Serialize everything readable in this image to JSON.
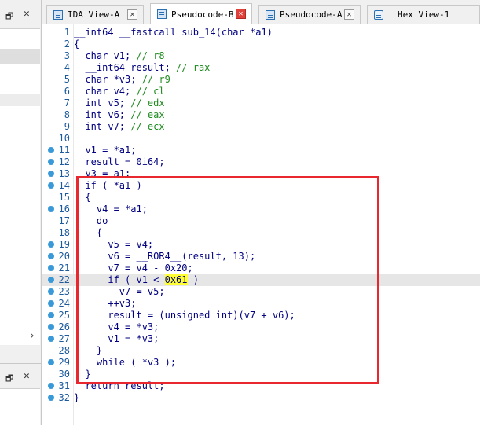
{
  "tabs": [
    {
      "label": "IDA View-A",
      "icon": "listing-icon",
      "active": false
    },
    {
      "label": "Pseudocode-B",
      "icon": "pseudocode-icon",
      "active": true
    },
    {
      "label": "Pseudocode-A",
      "icon": "pseudocode-icon",
      "active": false
    },
    {
      "label": "Hex View-1",
      "icon": "hex-icon",
      "active": false
    }
  ],
  "code": {
    "current_line": 22,
    "highlight_token": "0x61",
    "lines": [
      {
        "n": "1",
        "dot": false,
        "text": "__int64 __fastcall sub_14(char *a1)"
      },
      {
        "n": "2",
        "dot": false,
        "text": "{"
      },
      {
        "n": "3",
        "dot": false,
        "text": "  char v1; // r8"
      },
      {
        "n": "4",
        "dot": false,
        "text": "  __int64 result; // rax"
      },
      {
        "n": "5",
        "dot": false,
        "text": "  char *v3; // r9"
      },
      {
        "n": "6",
        "dot": false,
        "text": "  char v4; // cl"
      },
      {
        "n": "7",
        "dot": false,
        "text": "  int v5; // edx"
      },
      {
        "n": "8",
        "dot": false,
        "text": "  int v6; // eax"
      },
      {
        "n": "9",
        "dot": false,
        "text": "  int v7; // ecx"
      },
      {
        "n": "10",
        "dot": false,
        "text": ""
      },
      {
        "n": "11",
        "dot": true,
        "text": "  v1 = *a1;"
      },
      {
        "n": "12",
        "dot": true,
        "text": "  result = 0i64;"
      },
      {
        "n": "13",
        "dot": true,
        "text": "  v3 = a1;"
      },
      {
        "n": "14",
        "dot": true,
        "text": "  if ( *a1 )"
      },
      {
        "n": "15",
        "dot": false,
        "text": "  {"
      },
      {
        "n": "16",
        "dot": true,
        "text": "    v4 = *a1;"
      },
      {
        "n": "17",
        "dot": false,
        "text": "    do"
      },
      {
        "n": "18",
        "dot": false,
        "text": "    {"
      },
      {
        "n": "19",
        "dot": true,
        "text": "      v5 = v4;"
      },
      {
        "n": "20",
        "dot": true,
        "text": "      v6 = __ROR4__(result, 13);"
      },
      {
        "n": "21",
        "dot": true,
        "text": "      v7 = v4 - 0x20;"
      },
      {
        "n": "22",
        "dot": true,
        "text": "      if ( v1 < 0x61 )"
      },
      {
        "n": "23",
        "dot": true,
        "text": "        v7 = v5;"
      },
      {
        "n": "24",
        "dot": true,
        "text": "      ++v3;"
      },
      {
        "n": "25",
        "dot": true,
        "text": "      result = (unsigned int)(v7 + v6);"
      },
      {
        "n": "26",
        "dot": true,
        "text": "      v4 = *v3;"
      },
      {
        "n": "27",
        "dot": true,
        "text": "      v1 = *v3;"
      },
      {
        "n": "28",
        "dot": false,
        "text": "    }"
      },
      {
        "n": "29",
        "dot": true,
        "text": "    while ( *v3 );"
      },
      {
        "n": "30",
        "dot": false,
        "text": "  }"
      },
      {
        "n": "31",
        "dot": true,
        "text": "  return result;"
      },
      {
        "n": "32",
        "dot": true,
        "text": "}"
      }
    ]
  },
  "colors": {
    "annotation_box": "#e8282e",
    "highlight": "#ffff33",
    "breakpoint_dot": "#3a9ad9"
  }
}
